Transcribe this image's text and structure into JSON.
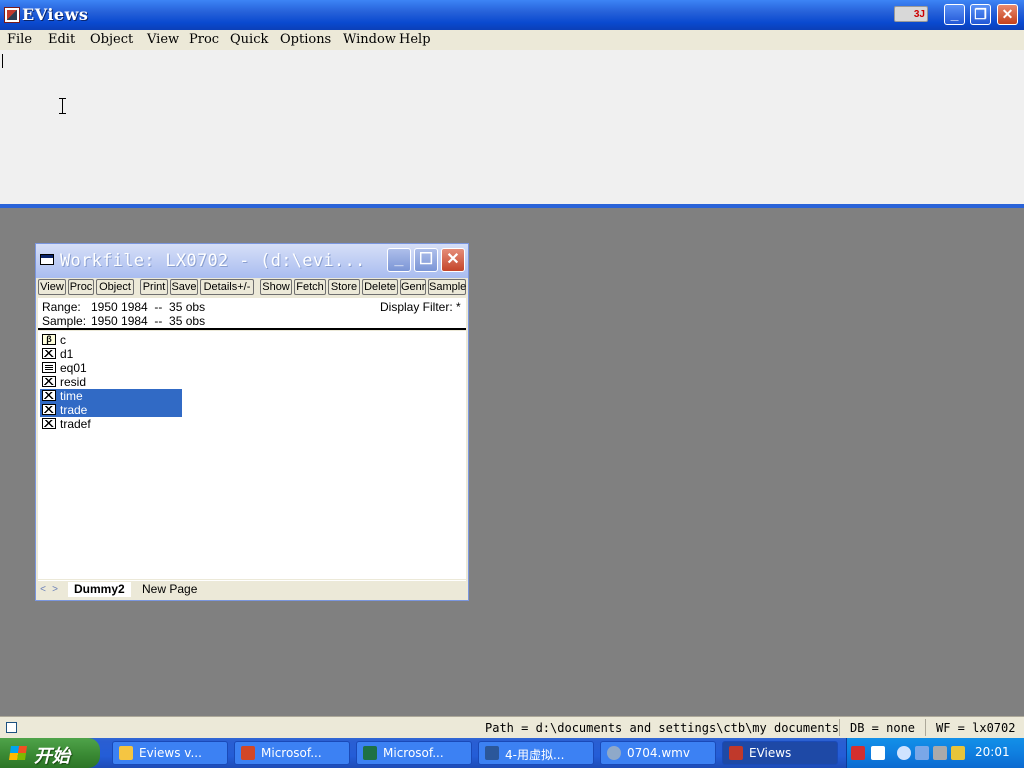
{
  "app": {
    "title": "EViews",
    "ime_label": "3J"
  },
  "menu": [
    "File",
    "Edit",
    "Object",
    "View",
    "Proc",
    "Quick",
    "Options",
    "Window",
    "Help"
  ],
  "workfile": {
    "title": "Workfile: LX0702 - (d:\\evi...",
    "toolbar": [
      "View",
      "Proc",
      "Object",
      "Print",
      "Save",
      "Details+/-",
      "Show",
      "Fetch",
      "Store",
      "Delete",
      "Genr",
      "Sample"
    ],
    "range_label": "Range:",
    "range_value": "1950 1984  --  35 obs",
    "sample_label": "Sample:",
    "sample_value": "1950 1984  --  35 obs",
    "display_filter": "Display Filter: *",
    "objects": [
      {
        "name": "c",
        "type": "coef",
        "selected": false
      },
      {
        "name": "d1",
        "type": "series",
        "selected": false
      },
      {
        "name": "eq01",
        "type": "equation",
        "selected": false
      },
      {
        "name": "resid",
        "type": "series",
        "selected": false
      },
      {
        "name": "time",
        "type": "series",
        "selected": true
      },
      {
        "name": "trade",
        "type": "series",
        "selected": true
      },
      {
        "name": "tradef",
        "type": "series",
        "selected": false
      }
    ],
    "coef_glyph": "β",
    "tabs": [
      "Dummy2",
      "New Page"
    ]
  },
  "statusbar": {
    "path": "Path = d:\\documents and settings\\ctb\\my documents",
    "db": "DB = none",
    "wf": "WF = lx0702"
  },
  "taskbar": {
    "start_label": "开始",
    "tasks": [
      {
        "label": "Eviews v...",
        "icon": "folder-icon",
        "color": "#f5c542",
        "active": false
      },
      {
        "label": "Microsof...",
        "icon": "powerpoint-icon",
        "color": "#d24726",
        "active": false
      },
      {
        "label": "Microsof...",
        "icon": "excel-icon",
        "color": "#1e7145",
        "active": false
      },
      {
        "label": "4-用虚拟...",
        "icon": "word-icon",
        "color": "#2b579a",
        "active": false
      },
      {
        "label": "0704.wmv",
        "icon": "media-player-icon",
        "color": "#8fa9c9",
        "active": false
      },
      {
        "label": "EViews",
        "icon": "eviews-icon",
        "color": "#c0392b",
        "active": true
      }
    ],
    "clock": "20:01"
  }
}
